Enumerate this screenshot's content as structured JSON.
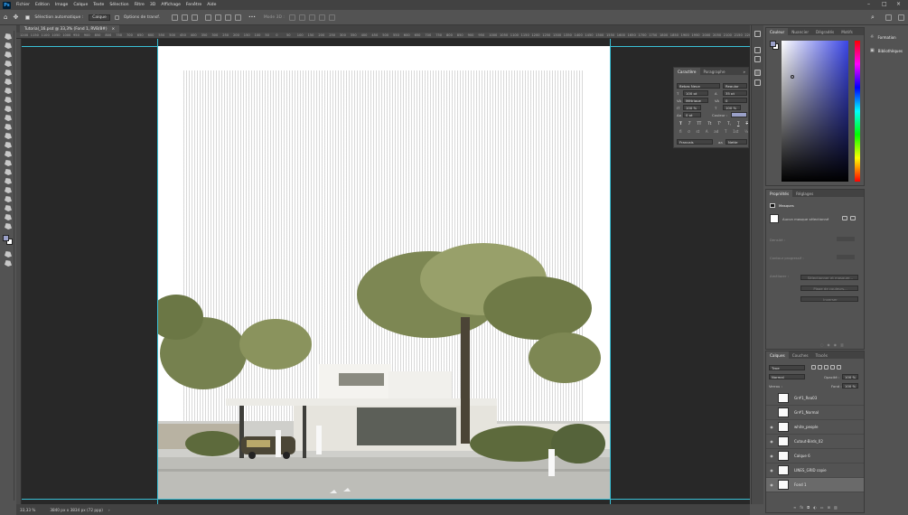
{
  "menubar": {
    "logo": "Ps",
    "items": [
      "Fichier",
      "Edition",
      "Image",
      "Calque",
      "Texte",
      "Sélection",
      "Filtre",
      "3D",
      "Affichage",
      "Fenêtre",
      "Aide"
    ]
  },
  "options_bar": {
    "auto_select_label": "Sélection automatique :",
    "auto_select_value": "Calque",
    "transform_label": "Options de transf.",
    "mode_3d": "Mode 3D :"
  },
  "document": {
    "tab_title": "Tutorial_16.psd @ 33,3% (Fond 1, RVB/8#)",
    "ruler_labels": [
      "1200",
      "1150",
      "1100",
      "1050",
      "1000",
      "950",
      "900",
      "850",
      "800",
      "750",
      "700",
      "650",
      "600",
      "550",
      "500",
      "450",
      "400",
      "350",
      "300",
      "250",
      "200",
      "150",
      "100",
      "50",
      "0",
      "50",
      "100",
      "150",
      "200",
      "250",
      "300",
      "350",
      "400",
      "450",
      "500",
      "550",
      "600",
      "650",
      "700",
      "750",
      "800",
      "850",
      "900",
      "950",
      "1000",
      "1050",
      "1100",
      "1150",
      "1200",
      "1250",
      "1300",
      "1350",
      "1400",
      "1450",
      "1500",
      "1550",
      "1600",
      "1650",
      "1700",
      "1750",
      "1800",
      "1850",
      "1900",
      "1950",
      "2000",
      "2050",
      "2100",
      "2150",
      "2200"
    ]
  },
  "status": {
    "zoom": "33,33 %",
    "size": "3840 px x 3834 px (72 ppp)"
  },
  "character_panel": {
    "tabs": [
      "Caractère",
      "Paragraphe"
    ],
    "font_family": "Bebas Neue",
    "font_style": "Regular",
    "font_size": "100 pt",
    "leading": "35 pt",
    "kerning": "Métrique",
    "tracking": "0",
    "vscale": "100 %",
    "hscale": "100 %",
    "baseline": "0 pt",
    "color_label": "Couleur :",
    "style_buttons": [
      "T",
      "T",
      "TT",
      "Tt",
      "T'",
      "T,",
      "T",
      "T"
    ],
    "ot_buttons": [
      "fi",
      "σ",
      "st",
      "A",
      "ad",
      "T",
      "1st",
      "½"
    ],
    "language": "Français",
    "aa_label": "aa",
    "aa_value": "Nette"
  },
  "color_panel": {
    "tabs": [
      "Couleur",
      "Nuancier",
      "Dégradés",
      "Motifs"
    ],
    "fg_color": "#9aa0c8",
    "hue_color": "#3b46e6"
  },
  "side_panel": {
    "items": [
      "Formation",
      "Bibliothèques"
    ]
  },
  "properties_panel": {
    "tabs": [
      "Propriétés",
      "Réglages"
    ],
    "mask_label": "Masques",
    "mask_none": "Aucun masque sélectionné",
    "density_label": "Densité :",
    "feather_label": "Contour progressif :",
    "refine_label": "Améliorer :",
    "select_mask_btn": "Sélectionner et masquer...",
    "color_range_btn": "Plage de couleurs...",
    "invert_btn": "Inverser"
  },
  "layers_panel": {
    "tabs": [
      "Calques",
      "Couches",
      "Tracés"
    ],
    "filter_label": "Type",
    "blend_mode": "Normal",
    "opacity_label": "Opacité :",
    "opacity_value": "100 %",
    "lock_label": "Verrou :",
    "fill_label": "Fond :",
    "fill_value": "100 %",
    "layers": [
      {
        "name": "Gr#1_Rea03",
        "visible": false
      },
      {
        "name": "Gr#1_Normal",
        "visible": false
      },
      {
        "name": "white_people",
        "visible": true
      },
      {
        "name": "Cutout-Birds_02",
        "visible": true
      },
      {
        "name": "Calque 6",
        "visible": true
      },
      {
        "name": "LINES_GRID copie",
        "visible": true
      },
      {
        "name": "Fond 1",
        "visible": true
      }
    ]
  }
}
